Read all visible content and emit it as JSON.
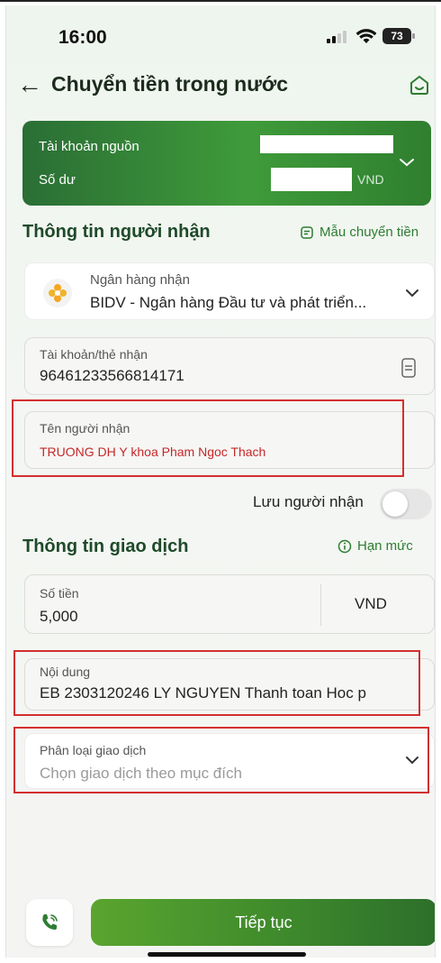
{
  "status_bar": {
    "time": "16:00",
    "battery": "73"
  },
  "header": {
    "title": "Chuyển tiền trong nước"
  },
  "source_account": {
    "account_label": "Tài khoản nguồn",
    "balance_label": "Số dư",
    "currency": "VND"
  },
  "recipient_section": {
    "title": "Thông tin người nhận",
    "template_link": "Mẫu chuyển tiền",
    "bank": {
      "label": "Ngân hàng nhận",
      "value": "BIDV - Ngân hàng Đầu tư và phát triển..."
    },
    "account": {
      "label": "Tài khoản/thẻ nhận",
      "value": "96461233566814171"
    },
    "name": {
      "label": "Tên người nhận",
      "value": "TRUONG DH Y khoa Pham Ngoc Thach"
    },
    "save_recipient_label": "Lưu người nhận",
    "save_recipient_on": false
  },
  "transaction_section": {
    "title": "Thông tin giao dịch",
    "limit_link": "Hạn mức",
    "amount": {
      "label": "Số tiền",
      "value": "5,000",
      "currency": "VND"
    },
    "content": {
      "label": "Nội dung",
      "value": "EB 2303120246 LY NGUYEN Thanh toan Hoc p"
    },
    "category": {
      "label": "Phân loại giao dịch",
      "placeholder": "Chọn giao dịch theo mục đích"
    }
  },
  "footer": {
    "continue_label": "Tiếp tục"
  },
  "colors": {
    "accent": "#2e7d32",
    "highlight": "#d32f2f",
    "recipient_name": "#c62828"
  }
}
